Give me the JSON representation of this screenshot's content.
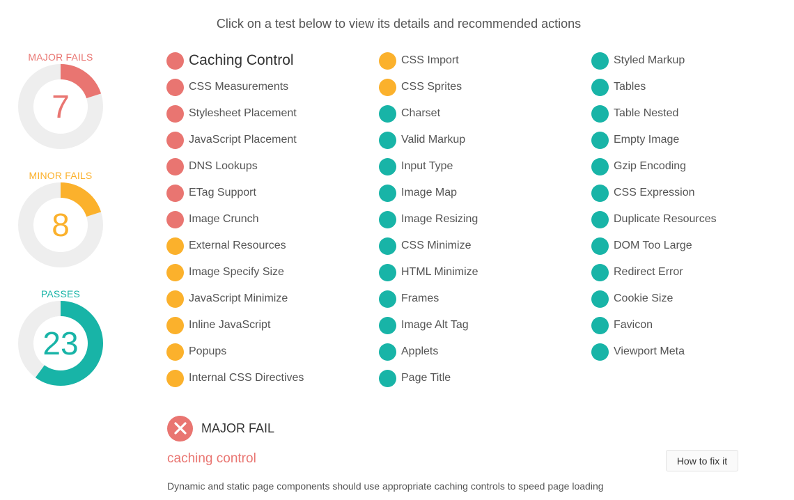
{
  "heading": "Click on a test below to view its details and recommended actions",
  "summary": {
    "major": {
      "label": "MAJOR FAILS",
      "count": "7",
      "color": "#e97571",
      "fraction": 0.2
    },
    "minor": {
      "label": "MINOR FAILS",
      "count": "8",
      "color": "#fbb12c",
      "fraction": 0.2
    },
    "pass": {
      "label": "PASSES",
      "count": "23",
      "color": "#18b4a7",
      "fraction": 0.6
    }
  },
  "colors": {
    "red": "#e97571",
    "orange": "#fbb12c",
    "teal": "#18b4a7",
    "track": "#eeeeee"
  },
  "tests": {
    "col1": [
      {
        "label": "Caching Control",
        "status": "red"
      },
      {
        "label": "CSS Measurements",
        "status": "red"
      },
      {
        "label": "Stylesheet Placement",
        "status": "red"
      },
      {
        "label": "JavaScript Placement",
        "status": "red"
      },
      {
        "label": "DNS Lookups",
        "status": "red"
      },
      {
        "label": "ETag Support",
        "status": "red"
      },
      {
        "label": "Image Crunch",
        "status": "red"
      },
      {
        "label": "External Resources",
        "status": "orange"
      },
      {
        "label": "Image Specify Size",
        "status": "orange"
      },
      {
        "label": "JavaScript Minimize",
        "status": "orange"
      },
      {
        "label": "Inline JavaScript",
        "status": "orange"
      },
      {
        "label": "Popups",
        "status": "orange"
      },
      {
        "label": "Internal CSS Directives",
        "status": "orange"
      }
    ],
    "col2": [
      {
        "label": "CSS Import",
        "status": "orange"
      },
      {
        "label": "CSS Sprites",
        "status": "orange"
      },
      {
        "label": "Charset",
        "status": "teal"
      },
      {
        "label": "Valid Markup",
        "status": "teal"
      },
      {
        "label": "Input Type",
        "status": "teal"
      },
      {
        "label": "Image Map",
        "status": "teal"
      },
      {
        "label": "Image Resizing",
        "status": "teal"
      },
      {
        "label": "CSS Minimize",
        "status": "teal"
      },
      {
        "label": "HTML Minimize",
        "status": "teal"
      },
      {
        "label": "Frames",
        "status": "teal"
      },
      {
        "label": "Image Alt Tag",
        "status": "teal"
      },
      {
        "label": "Applets",
        "status": "teal"
      },
      {
        "label": "Page Title",
        "status": "teal"
      }
    ],
    "col3": [
      {
        "label": "Styled Markup",
        "status": "teal"
      },
      {
        "label": "Tables",
        "status": "teal"
      },
      {
        "label": "Table Nested",
        "status": "teal"
      },
      {
        "label": "Empty Image",
        "status": "teal"
      },
      {
        "label": "Gzip Encoding",
        "status": "teal"
      },
      {
        "label": "CSS Expression",
        "status": "teal"
      },
      {
        "label": "Duplicate Resources",
        "status": "teal"
      },
      {
        "label": "DOM Too Large",
        "status": "teal"
      },
      {
        "label": "Redirect Error",
        "status": "teal"
      },
      {
        "label": "Cookie Size",
        "status": "teal"
      },
      {
        "label": "Favicon",
        "status": "teal"
      },
      {
        "label": "Viewport Meta",
        "status": "teal"
      }
    ]
  },
  "detail": {
    "status_icon": "close-circle-icon",
    "status_title": "MAJOR FAIL",
    "test_name": "caching control",
    "fix_button": "How to fix it",
    "description": "Dynamic and static page components should use appropriate caching controls to speed page loading"
  }
}
